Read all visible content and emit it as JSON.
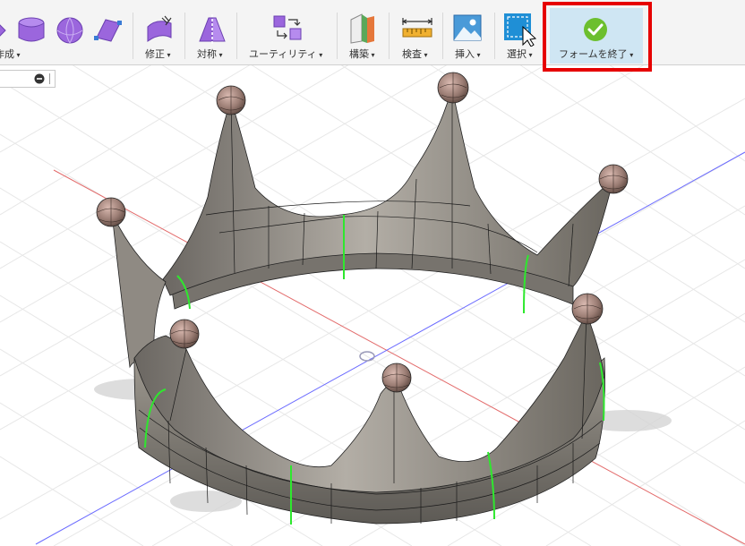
{
  "toolbar": {
    "create_label": "作成",
    "modify_label": "修正",
    "symmetry_label": "対称",
    "utility_label": "ユーティリティ",
    "construct_label": "構築",
    "inspect_label": "検査",
    "insert_label": "挿入",
    "select_label": "選択",
    "finish_form_label": "フォームを終了"
  },
  "icons": {
    "create": [
      "box-form-icon",
      "cylinder-form-icon",
      "sphere-form-icon",
      "plane-form-icon"
    ],
    "modify": "edit-form-icon",
    "symmetry": "mirror-icon",
    "utility": "utility-icon",
    "construct": "construct-plane-icon",
    "inspect": "measure-icon",
    "insert": "insert-image-icon",
    "select": "selection-icon",
    "finish_form": "checkmark-icon"
  },
  "colors": {
    "finish_form_check": "#6cbf2e",
    "finish_form_bg": "#cfe6f3",
    "highlight_border": "#e60000",
    "form_icon_purple": "#9b66dd",
    "model_gray": "#8a8680",
    "symmetry_line_green": "#2ee82e",
    "axis_red": "#e36b6b",
    "axis_blue": "#6b6bff"
  },
  "viewport": {
    "model": "crown-tspline-body",
    "crown_points": 7
  }
}
